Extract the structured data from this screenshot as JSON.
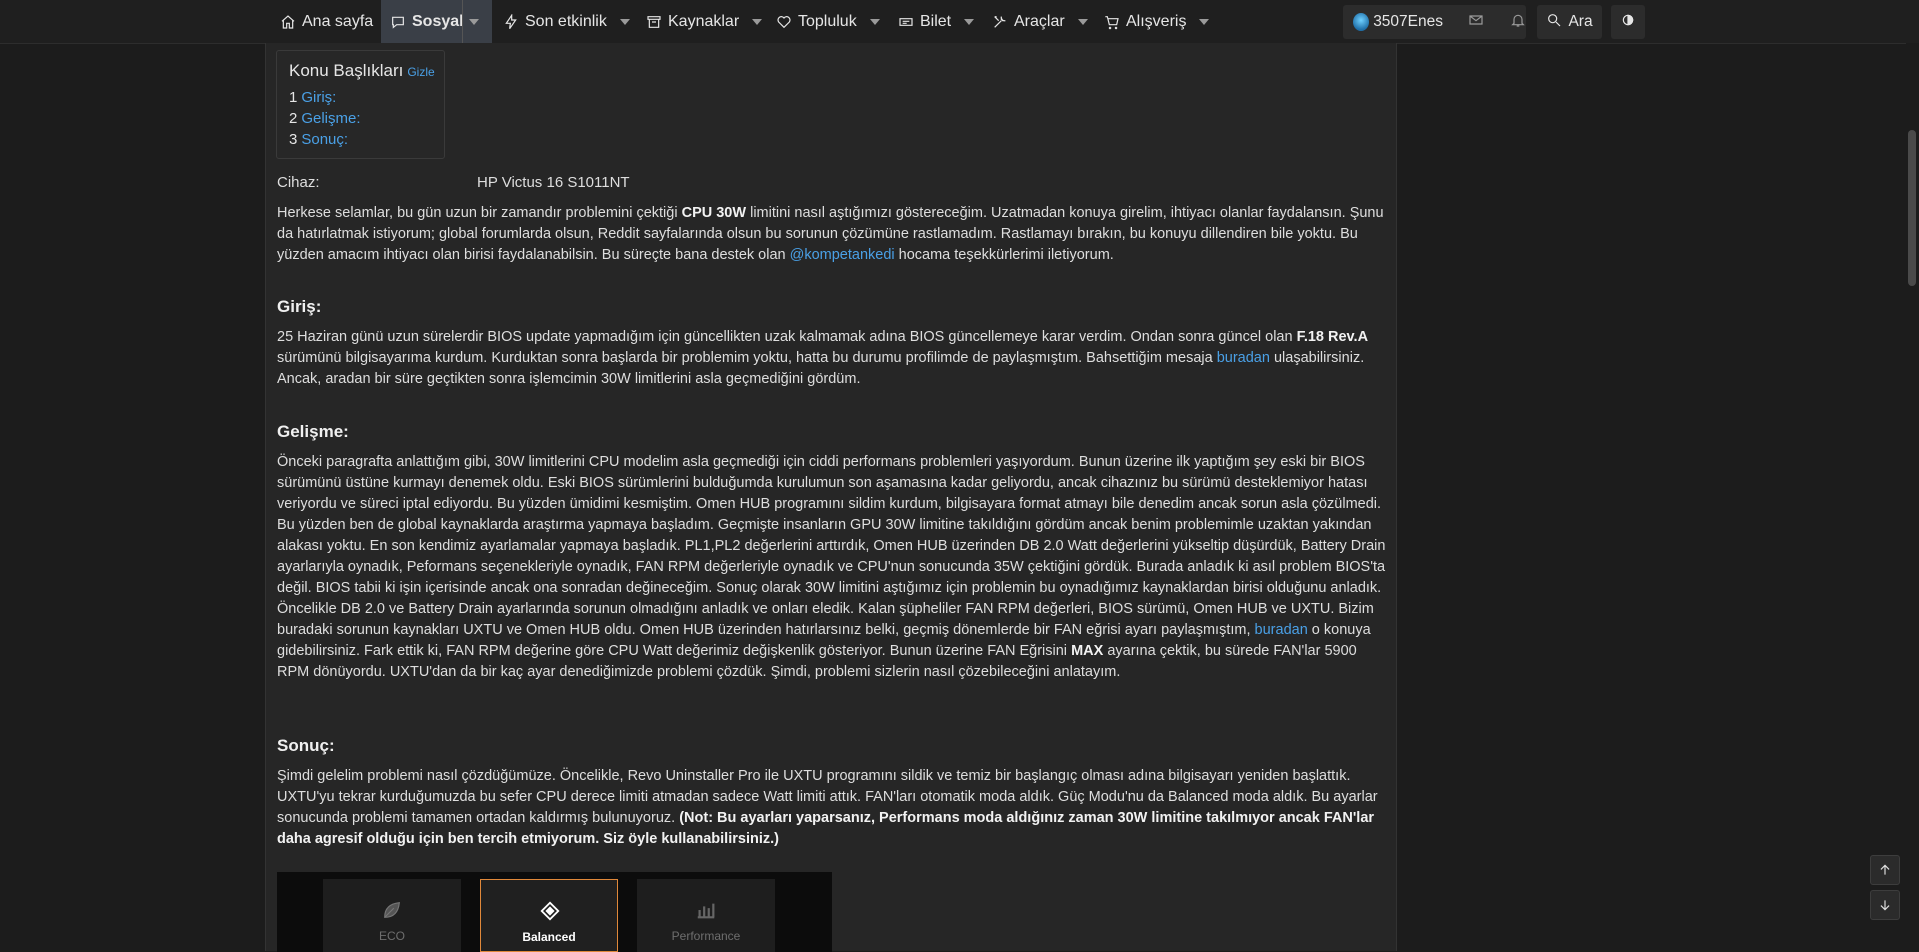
{
  "nav": {
    "items": [
      {
        "label": "Ana sayfa",
        "icon": "home-icon"
      },
      {
        "label": "Sosyal",
        "icon": "chat-icon"
      },
      {
        "label": "Son etkinlik",
        "icon": "lightning-icon"
      },
      {
        "label": "Kaynaklar",
        "icon": "archive-icon"
      },
      {
        "label": "Topluluk",
        "icon": "heart-icon"
      },
      {
        "label": "Bilet",
        "icon": "ticket-icon"
      },
      {
        "label": "Araçlar",
        "icon": "tools-icon"
      },
      {
        "label": "Alışveriş",
        "icon": "cart-icon"
      }
    ],
    "username": "3507Enes",
    "search_label": "Ara"
  },
  "toc": {
    "title": "Konu Başlıkları",
    "hide_label": "Gizle",
    "entries": [
      {
        "num": "1",
        "label": "Giriş:"
      },
      {
        "num": "2",
        "label": "Gelişme:"
      },
      {
        "num": "3",
        "label": "Sonuç:"
      }
    ]
  },
  "device": {
    "label": "Cihaz:",
    "value": "HP Victus 16 S1011NT"
  },
  "intro": {
    "p1_a": "Herkese selamlar, bu gün uzun bir zamandır problemini çektiği ",
    "p1_bold": "CPU 30W",
    "p1_b": " limitini nasıl aştığımızı göstereceğim. Uzatmadan konuya girelim, ihtiyacı olanlar faydalansın. Şunu da hatırlatmak istiyorum; global forumlarda olsun, Reddit sayfalarında olsun bu sorunun çözümüne rastlamadım. Rastlamayı bırakın, bu konuyu dillendiren bile yoktu. Bu yüzden amacım ihtiyacı olan birisi faydalanabilsin. Bu süreçte bana destek olan ",
    "mention": "@kompetankedi",
    "p1_c": " hocama teşekkürlerimi iletiyorum."
  },
  "giris": {
    "heading": "Giriş:",
    "p_a": "25 Haziran günü uzun sürelerdir BIOS update yapmadığım için güncellikten uzak kalmamak adına BIOS güncellemeye karar verdim. Ondan sonra güncel olan ",
    "p_bold": "F.18 Rev.A",
    "p_b": " sürümünü bilgisayarıma kurdum. Kurduktan sonra başlarda bir problemim yoktu, hatta bu durumu profilimde de paylaşmıştım. Bahsettiğim mesaja ",
    "p_link": "buradan",
    "p_c": " ulaşabilirsiniz. Ancak, aradan bir süre geçtikten sonra işlemcimin 30W limitlerini asla geçmediğini gördüm."
  },
  "gelisme": {
    "heading": "Gelişme:",
    "p_a": "Önceki paragrafta anlattığım gibi, 30W limitlerini CPU modelim asla geçmediği için ciddi performans problemleri yaşıyordum. Bunun üzerine ilk yaptığım şey eski bir BIOS sürümünü üstüne kurmayı denemek oldu. Eski BIOS sürümlerini bulduğumda kurulumun son aşamasına kadar geliyordu, ancak cihazınız bu sürümü desteklemiyor hatası veriyordu ve süreci iptal ediyordu. Bu yüzden ümidimi kesmiştim. Omen HUB programını sildim kurdum, bilgisayara format atmayı bile denedim ancak sorun asla çözülmedi. Bu yüzden ben de global kaynaklarda araştırma yapmaya başladım. Geçmişte insanların GPU 30W limitine takıldığını gördüm ancak benim problemimle uzaktan yakından alakası yoktu. En son kendimiz ayarlamalar yapmaya başladık. PL1,PL2 değerlerini arttırdık, Omen HUB üzerinden DB 2.0 Watt değerlerini yükseltip düşürdük, Battery Drain ayarlarıyla oynadık, Peformans seçenekleriyle oynadık, FAN RPM değerleriyle oynadık ve CPU'nun sonucunda 35W çektiğini gördük. Burada anladık ki asıl problem BIOS'ta değil. BIOS tabii ki işin içerisinde ancak ona sonradan değineceğim. Sonuç olarak 30W limitini aştığımız için problemin bu oynadığımız kaynaklardan birisi olduğunu anladık. Öncelikle DB 2.0 ve Battery Drain ayarlarında sorunun olmadığını anladık ve onları eledik. Kalan şüpheliler FAN RPM değerleri, BIOS sürümü, Omen HUB ve UXTU. Bizim buradaki sorunun kaynakları UXTU ve Omen HUB oldu. Omen HUB üzerinden hatırlarsınız belki, geçmiş dönemlerde bir FAN eğrisi ayarı paylaşmıştım, ",
    "p_link": "buradan",
    "p_b": " o konuya gidebilirsiniz. Fark ettik ki, FAN RPM değerine göre CPU Watt değerimiz değişkenlik gösteriyor. Bunun üzerine FAN Eğrisini ",
    "p_bold": "MAX",
    "p_c": " ayarına çektik, bu sürede FAN'lar 5900 RPM dönüyordu. UXTU'dan da bir kaç ayar denediğimizde problemi çözdük. Şimdi, problemi sizlerin nasıl çözebileceğini anlatayım."
  },
  "sonuc": {
    "heading": "Sonuç:",
    "p_a": "Şimdi gelelim problemi nasıl çözdüğümüze. Öncelikle, Revo Uninstaller Pro ile UXTU programını sildik ve temiz bir başlangıç olması adına bilgisayarı yeniden başlattık. UXTU'yu tekrar kurduğumuzda bu sefer CPU derece limiti atmadan sadece Watt limiti attık. FAN'ları otomatik moda aldık. Güç Modu'nu da Balanced moda aldık. Bu ayarlar sonucunda problemi tamamen ortadan kaldırmış bulunuyoruz. ",
    "p_bold": "(Not: Bu ayarları yaparsanız, Performans moda aldığınız zaman 30W limitine takılmıyor ancak FAN'lar daha agresif olduğu için ben tercih etmiyorum. Siz öyle kullanabilirsiniz.)"
  },
  "modes": [
    {
      "label": "ECO",
      "icon": "leaf-icon",
      "active": false
    },
    {
      "label": "Balanced",
      "icon": "diamond-icon",
      "active": true
    },
    {
      "label": "Performance",
      "icon": "bars-icon",
      "active": false
    }
  ],
  "colors": {
    "link": "#4aa0e6",
    "accent_border": "#e0883a",
    "nav_active": "#3a3f47"
  }
}
